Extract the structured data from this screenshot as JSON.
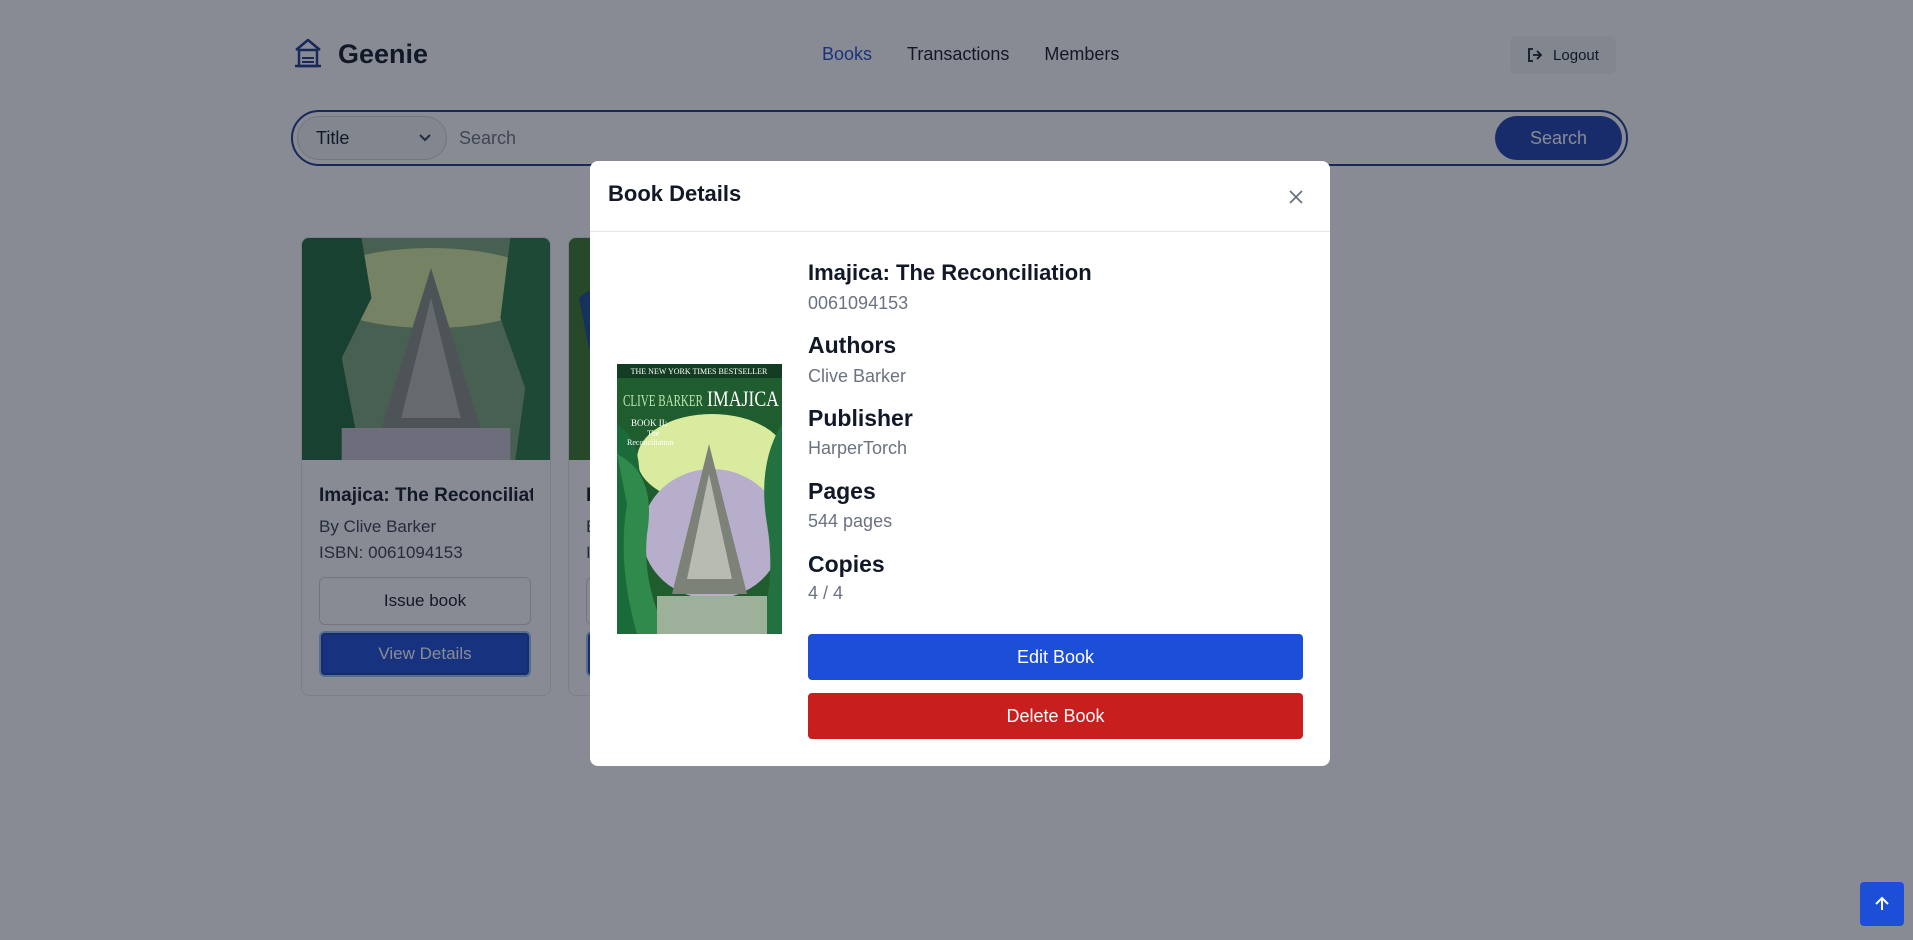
{
  "app": {
    "name": "Geenie"
  },
  "nav": {
    "books": "Books",
    "transactions": "Transactions",
    "members": "Members"
  },
  "logout_label": "Logout",
  "search": {
    "field_selected": "Title",
    "placeholder": "Search",
    "button_label": "Search"
  },
  "cards": [
    {
      "title": "Imajica: The Reconciliation",
      "author_line": "By Clive Barker",
      "isbn_line": "ISBN: 0061094153",
      "issue_label": "Issue book",
      "view_label": "View Details"
    },
    {
      "title": "I",
      "author_line": "B",
      "isbn_line": "I",
      "issue_label": "",
      "view_label": ""
    }
  ],
  "modal": {
    "header": "Book Details",
    "title": "Imajica: The Reconciliation",
    "isbn": "0061094153",
    "authors_heading": "Authors",
    "authors": "Clive Barker",
    "publisher_heading": "Publisher",
    "publisher": "HarperTorch",
    "pages_heading": "Pages",
    "pages": "544 pages",
    "copies_heading": "Copies",
    "copies": "4 / 4",
    "edit_label": "Edit Book",
    "delete_label": "Delete Book",
    "cover_text": {
      "banner": "THE NEW YORK TIMES BESTSELLER",
      "author": "CLIVE BARKER",
      "title": "IMAJICA",
      "book": "BOOK II:",
      "subtitle_1": "The",
      "subtitle_2": "Reconciliation"
    }
  },
  "colors": {
    "primary": "#1d4ed8",
    "danger": "#c81e1e",
    "overlay": "rgba(17,24,39,0.5)"
  },
  "icons": {
    "brand": "library-icon",
    "logout": "logout-icon",
    "select": "chevron-down-icon",
    "close": "close-icon",
    "scroll_top": "arrow-up-icon"
  }
}
